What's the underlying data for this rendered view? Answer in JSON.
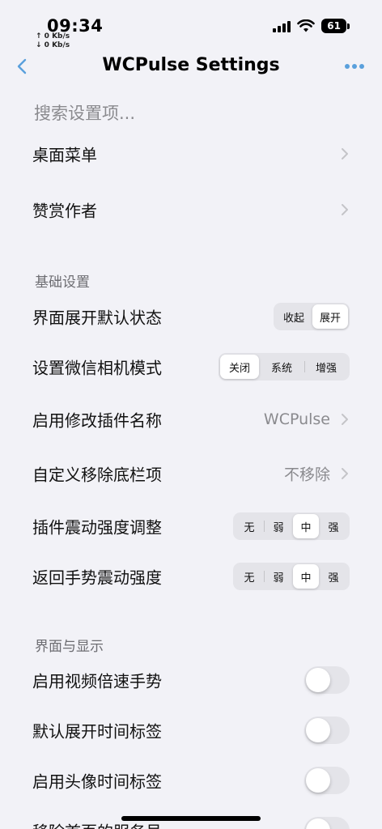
{
  "status": {
    "time": "09:34",
    "net_up": "↑ 0 Kb/s",
    "net_down": "↓ 0 Kb/s",
    "battery": "61"
  },
  "nav": {
    "title": "WCPulse Settings"
  },
  "search": {
    "placeholder": "搜索设置项..."
  },
  "top_items": [
    {
      "label": "桌面菜单"
    },
    {
      "label": "赞赏作者"
    }
  ],
  "section_basic": {
    "header": "基础设置",
    "expand_default": {
      "label": "界面展开默认状态",
      "options": [
        "收起",
        "展开"
      ],
      "selected": "展开"
    },
    "camera_mode": {
      "label": "设置微信相机模式",
      "options": [
        "关闭",
        "系统",
        "增强"
      ],
      "selected": "关闭"
    },
    "rename_plugin": {
      "label": "启用修改插件名称",
      "value": "WCPulse"
    },
    "remove_tabbar": {
      "label": "自定义移除底栏项",
      "value": "不移除"
    },
    "plugin_vibration": {
      "label": "插件震动强度调整",
      "options": [
        "无",
        "弱",
        "中",
        "强"
      ],
      "selected": "中"
    },
    "back_vibration": {
      "label": "返回手势震动强度",
      "options": [
        "无",
        "弱",
        "中",
        "强"
      ],
      "selected": "中"
    }
  },
  "section_display": {
    "header": "界面与显示",
    "toggles": [
      {
        "label": "启用视频倍速手势",
        "on": false
      },
      {
        "label": "默认展开时间标签",
        "on": false
      },
      {
        "label": "启用头像时间标签",
        "on": false
      },
      {
        "label": "移除首页的服务号",
        "on": false
      }
    ]
  },
  "colors": {
    "accent": "#5aa0dc",
    "background": "#f2f2f7",
    "secondary_text": "#8a8a8e"
  }
}
